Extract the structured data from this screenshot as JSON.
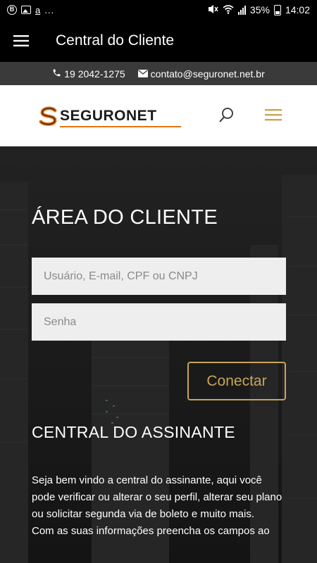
{
  "status_bar": {
    "time": "14:02",
    "battery": "35%",
    "left_icons": [
      "b-circle-icon",
      "image-icon",
      "a-underline-icon",
      "more-dots-icon"
    ],
    "right_icons": [
      "mute-vibrate-icon",
      "wifi-icon",
      "signal-icon",
      "battery-icon"
    ],
    "b_label": "B",
    "a_label": "a",
    "dots": "..."
  },
  "app_bar": {
    "title": "Central do Cliente"
  },
  "contact": {
    "phone": "19 2042-1275",
    "email": "contato@seguronet.net.br"
  },
  "header": {
    "logo_text_main": "SEGURO",
    "logo_text_accent": "NET",
    "logo_s": "S"
  },
  "login": {
    "title": "ÁREA DO CLIENTE",
    "user_placeholder": "Usuário, E-mail, CPF ou CNPJ",
    "user_value": "",
    "password_placeholder": "Senha",
    "password_value": "",
    "button_label": "Conectar"
  },
  "central": {
    "title": "CENTRAL DO ASSINANTE",
    "paragraph_1": "Seja bem vindo a central do assinante, aqui você pode verificar ou alterar o seu perfil, alterar seu plano ou solicitar segunda via de boleto e muito mais.",
    "paragraph_2": "Com as suas informações preencha os campos ao"
  },
  "colors": {
    "accent_gold": "#c9a556",
    "brand_orange": "#e8751a",
    "appbar_bg": "#000000",
    "contact_bg": "#3a3a3a"
  }
}
